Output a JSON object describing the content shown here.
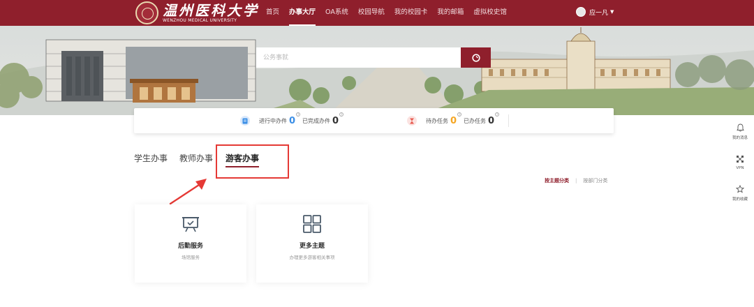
{
  "brand": {
    "name_cn": "温州医科大学",
    "name_en": "WENZHOU MEDICAL UNIVERSITY"
  },
  "nav": {
    "items": [
      {
        "label": "首页"
      },
      {
        "label": "办事大厅"
      },
      {
        "label": "OA系统"
      },
      {
        "label": "校园导航"
      },
      {
        "label": "我的校园卡"
      },
      {
        "label": "我的邮箱"
      },
      {
        "label": "虚拟校史馆"
      }
    ],
    "active_index": 1
  },
  "user": {
    "name": "应一凡"
  },
  "search": {
    "placeholder": "公务事就"
  },
  "stats": {
    "in_progress": {
      "label": "进行中办件",
      "value": "0"
    },
    "completed": {
      "label": "已完成办件",
      "value": "0"
    },
    "todo": {
      "label": "待办任务",
      "value": "0"
    },
    "done": {
      "label": "已办任务",
      "value": "0"
    }
  },
  "tabs": [
    {
      "label": "学生办事"
    },
    {
      "label": "教师办事"
    },
    {
      "label": "游客办事"
    }
  ],
  "active_tab": 2,
  "filters": {
    "by_topic": "按主题分类",
    "separator": "|",
    "by_department": "按部门分类"
  },
  "cards": [
    {
      "title": "后勤服务",
      "desc": "场馆服务",
      "icon": "presentation-board-icon"
    },
    {
      "title": "更多主题",
      "desc": "办理更多游客相关事项",
      "icon": "grid-icon"
    }
  ],
  "sidebar": [
    {
      "label": "我的消息",
      "icon": "bell-icon"
    },
    {
      "label": "VPN",
      "icon": "network-icon"
    },
    {
      "label": "我的收藏",
      "icon": "star-icon"
    }
  ],
  "colors": {
    "brand": "#8f1f2c",
    "annotation": "#e53935",
    "stat_blue": "#3a8ee6",
    "stat_red": "#e85a4f",
    "stat_orange": "#f5a623"
  }
}
